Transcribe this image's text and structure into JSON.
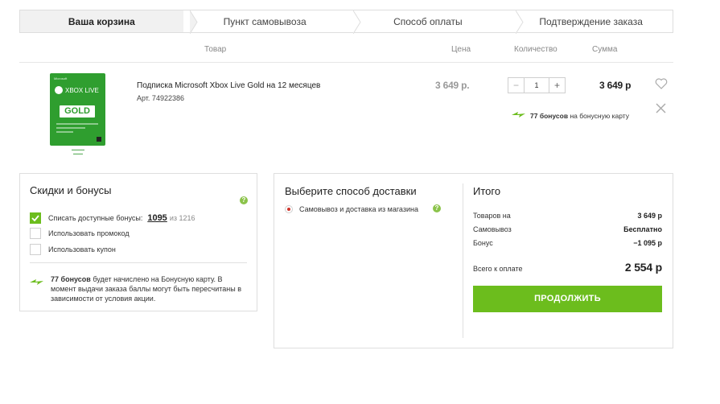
{
  "steps": [
    {
      "label": "Ваша корзина",
      "active": true
    },
    {
      "label": "Пункт самовывоза",
      "active": false
    },
    {
      "label": "Способ оплаты",
      "active": false
    },
    {
      "label": "Подтверждение заказа",
      "active": false
    }
  ],
  "table_header": {
    "product": "Товар",
    "price": "Цена",
    "quantity": "Количество",
    "sum": "Сумма"
  },
  "product": {
    "image_alt": "Xbox Live Gold",
    "image_brand": "Microsoft",
    "image_product": "XBOX LIVE",
    "image_badge": "GOLD",
    "title": "Подписка Microsoft Xbox Live Gold на 12 месяцев",
    "article": "Арт. 74922386",
    "price": "3 649 р.",
    "quantity": "1",
    "minus": "−",
    "plus": "+",
    "sum": "3 649 р",
    "bonus_amount": "77 бонусов",
    "bonus_text": "на бонусную карту"
  },
  "discounts": {
    "title": "Скидки и бонусы",
    "help": "?",
    "use_bonuses_label": "Списать доступные бонусы:",
    "use_bonuses_checked": true,
    "bonuses_value": "1095",
    "bonuses_of": "из 1216",
    "promo_label": "Использовать промокод",
    "coupon_label": "Использовать купон",
    "info_bold": "77 бонусов",
    "info_text": " будет начислено на Бонусную карту. В момент выдачи заказа баллы могут быть пересчитаны в зависимости от условия акции."
  },
  "delivery": {
    "title": "Выберите способ доставки",
    "option_label": "Самовывоз и доставка из магазина",
    "help": "?"
  },
  "total": {
    "title": "Итого",
    "rows": [
      {
        "label": "Товаров на",
        "value": "3 649 р"
      },
      {
        "label": "Самовывоз",
        "value": "Бесплатно"
      },
      {
        "label": "Бонус",
        "value": "−1 095 р"
      }
    ],
    "grand_label": "Всего к оплате",
    "grand_value": "2 554 р",
    "cta": "ПРОДОЛЖИТЬ"
  },
  "colors": {
    "accent": "#6cbd1d",
    "product_green": "#2f9e2f",
    "radio_dot": "#d0342c"
  }
}
